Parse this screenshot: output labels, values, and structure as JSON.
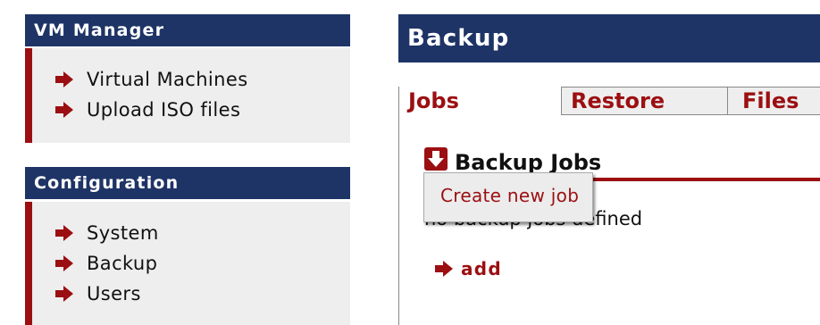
{
  "sidebar": {
    "sections": [
      {
        "title": "VM Manager",
        "items": [
          {
            "label": "Virtual Machines",
            "icon": "arrow-right-icon"
          },
          {
            "label": "Upload ISO files",
            "icon": "arrow-right-icon"
          }
        ]
      },
      {
        "title": "Configuration",
        "items": [
          {
            "label": "System",
            "icon": "arrow-right-icon"
          },
          {
            "label": "Backup",
            "icon": "arrow-right-icon"
          },
          {
            "label": "Users",
            "icon": "arrow-right-icon"
          }
        ]
      }
    ]
  },
  "main": {
    "title": "Backup",
    "tabs": [
      {
        "label": "Jobs",
        "active": true
      },
      {
        "label": "Restore",
        "active": false
      },
      {
        "label": "Files",
        "active": false
      }
    ],
    "section_title": "Backup Jobs",
    "empty_message": "no backup jobs defined",
    "add_label": "add"
  },
  "popup": {
    "item_label": "Create new job"
  },
  "colors": {
    "header_bg": "#1e3466",
    "accent": "#9b0f12",
    "panel_bg": "#eeeeee"
  }
}
